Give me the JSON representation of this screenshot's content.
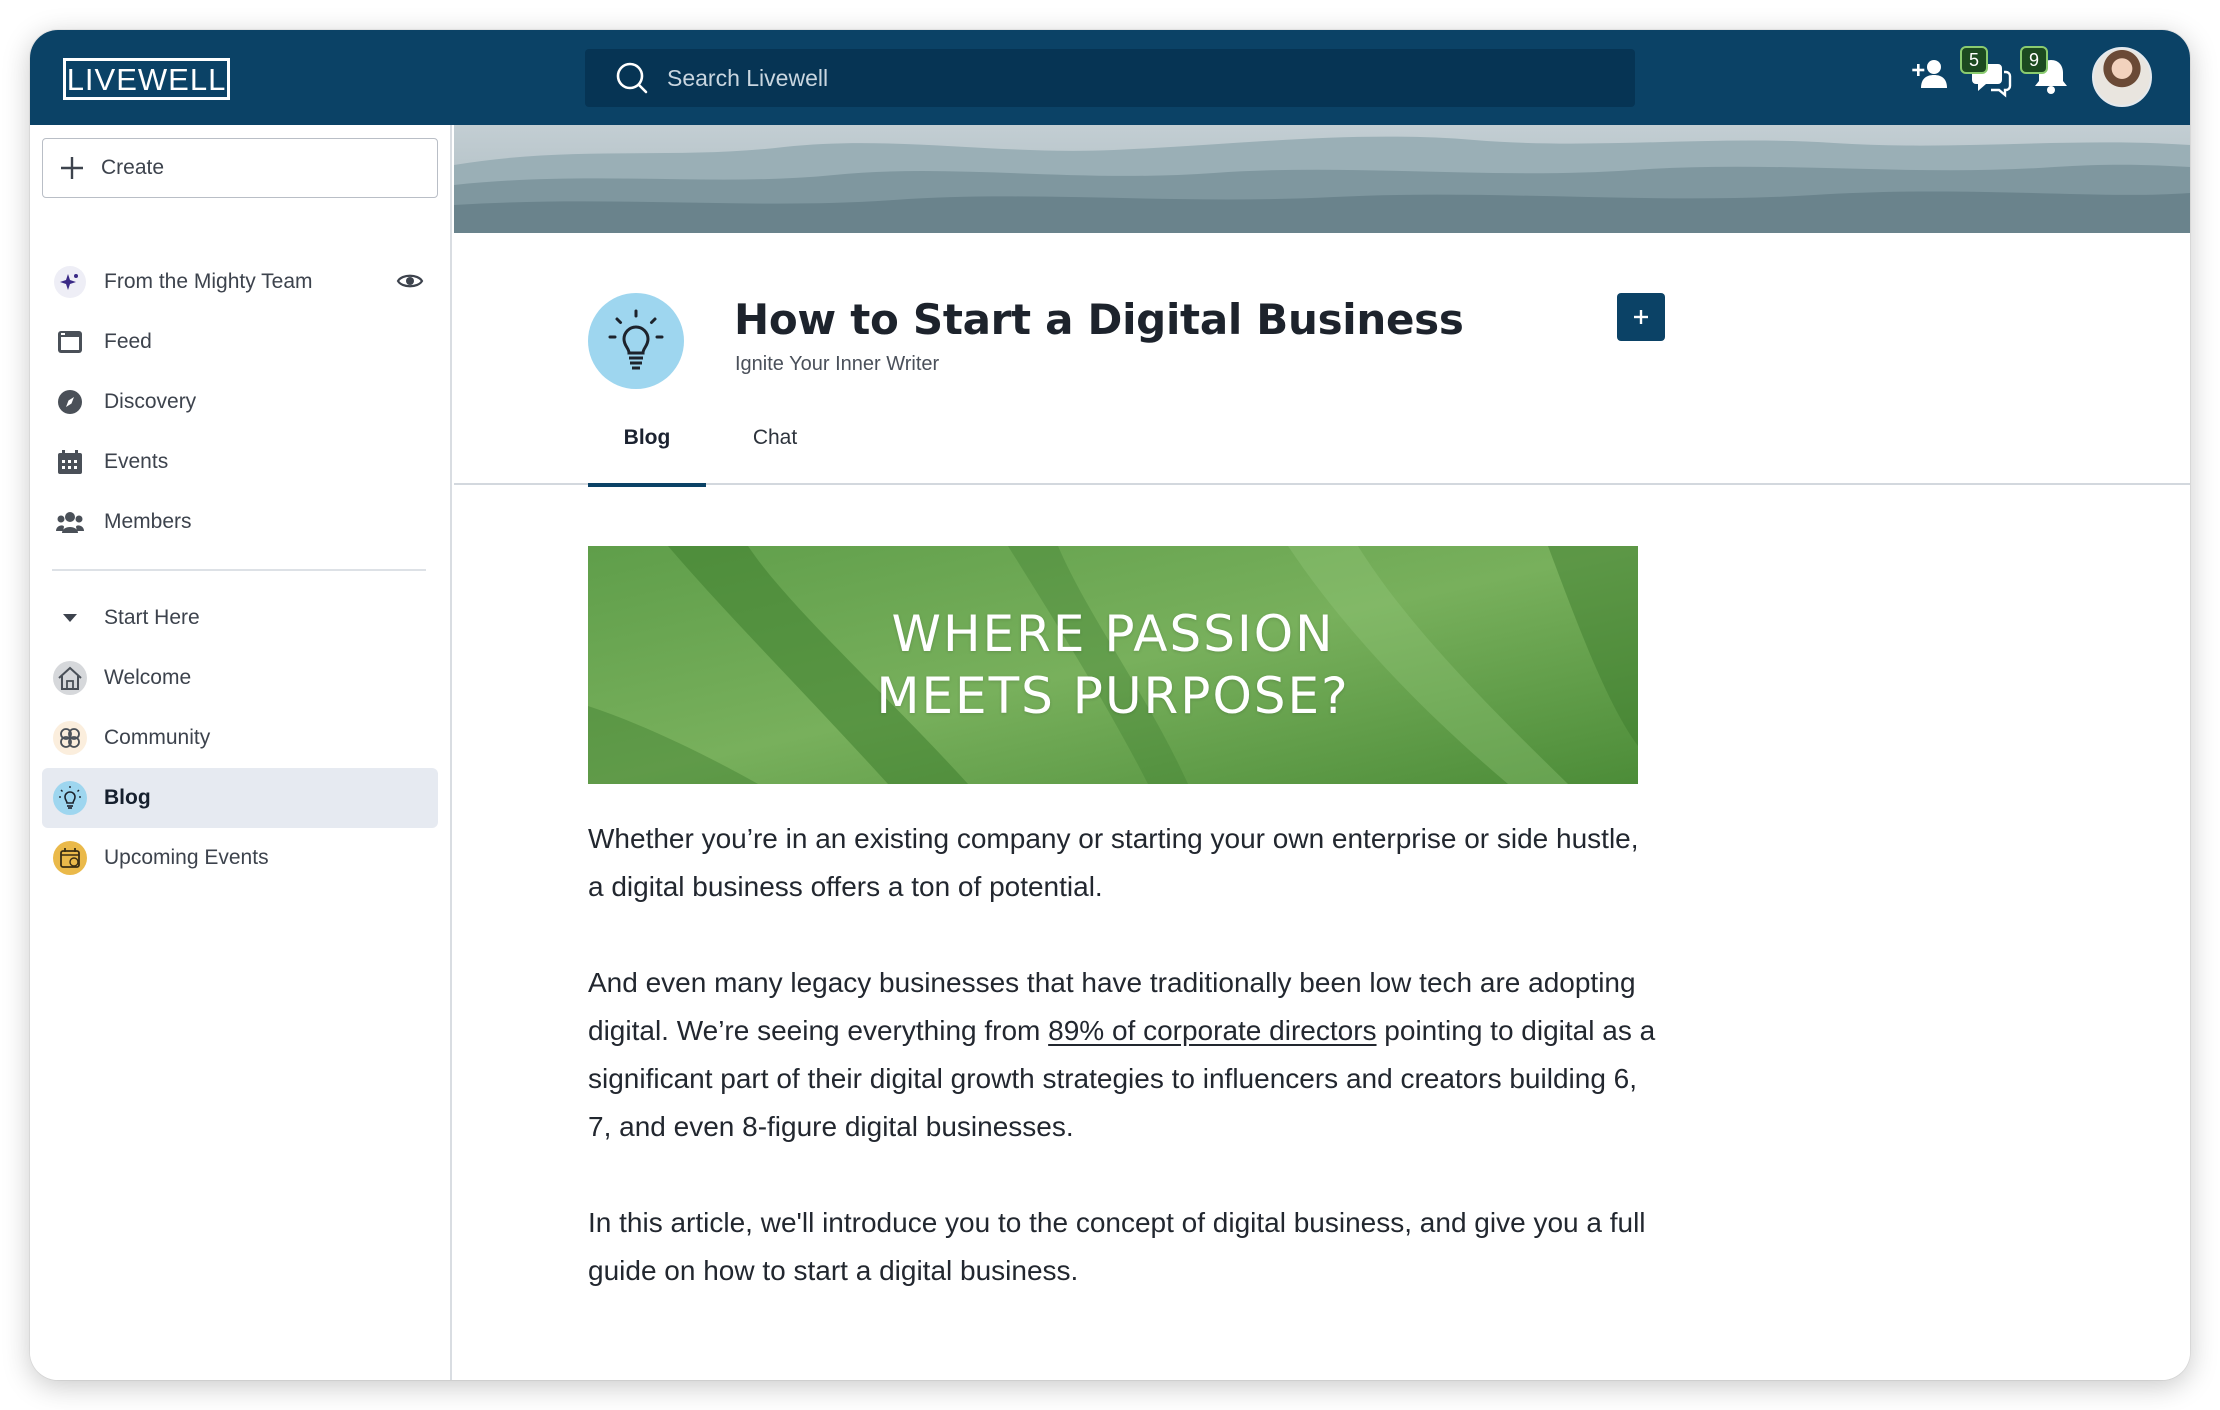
{
  "app": {
    "logo": "LIVEWELL"
  },
  "search": {
    "placeholder": "Search Livewell"
  },
  "header_icons": {
    "chat_count": "5",
    "notification_count": "9",
    "icons": [
      "add-user-icon",
      "chat-icon",
      "bell-icon"
    ]
  },
  "colors": {
    "topbar": "#0b4266",
    "active_nav": "#e6eaf1",
    "badge": "#1c4a20"
  },
  "sidebar": {
    "create_label": "Create",
    "primary": [
      {
        "label": "From the Mighty Team",
        "icon": "sparkle-icon"
      },
      {
        "label": "Feed",
        "icon": "feed-icon"
      },
      {
        "label": "Discovery",
        "icon": "compass-icon"
      },
      {
        "label": "Events",
        "icon": "calendar-icon"
      },
      {
        "label": "Members",
        "icon": "members-icon"
      }
    ],
    "section_label": "Start Here",
    "spaces": [
      {
        "label": "Welcome",
        "icon": "house-icon"
      },
      {
        "label": "Community",
        "icon": "flower-icon"
      },
      {
        "label": "Blog",
        "icon": "lightbulb-icon",
        "active": true
      },
      {
        "label": "Upcoming Events",
        "icon": "calendar-check-icon"
      }
    ]
  },
  "page": {
    "title": "How to Start a Digital Business",
    "subtitle": "Ignite Your Inner Writer",
    "add_button": "+",
    "tabs": [
      "Blog",
      "Chat"
    ],
    "active_tab": "Blog"
  },
  "hero": {
    "line1": "WHERE PASSION",
    "line2": "MEETS PURPOSE?"
  },
  "article": {
    "p1": "Whether you’re in an existing company or  starting your own enterprise or side hustle, a digital business offers a  ton of potential.",
    "p2_before": "And even many legacy businesses that have traditionally been low tech are adopting digital.  We’re seeing everything from ",
    "p2_link": "89% of corporate directors",
    "p2_after": " pointing to digital as a significant part of their digital growth  strategies to influencers and creators building 6, 7, and even 8-figure  digital businesses.",
    "p3": "In  this article, we'll introduce you to the concept of digital business,  and give you a full guide on how to start a digital business."
  }
}
